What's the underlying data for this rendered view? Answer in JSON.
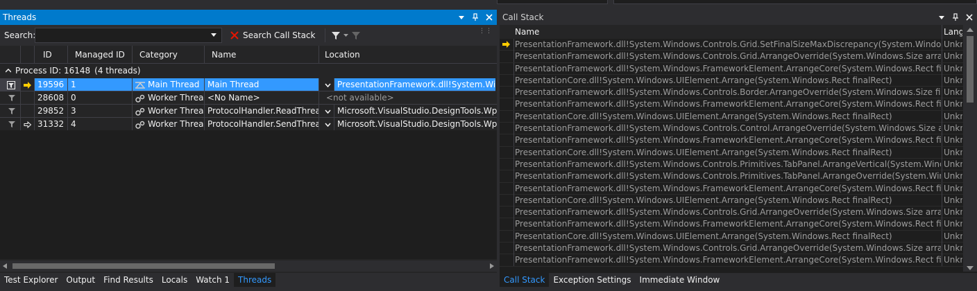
{
  "threads_panel": {
    "title": "Threads",
    "search_label": "Search:",
    "search_value": "",
    "search_call_stack_label": "Search Call Stack",
    "columns": [
      "ID",
      "Managed ID",
      "Category",
      "Name",
      "Location"
    ],
    "group_label": "Process ID: 16148",
    "group_count": "(4 threads)",
    "rows": [
      {
        "id": "19596",
        "managed_id": "1",
        "category": "Main Thread",
        "name": "Main Thread",
        "location": "PresentationFramework.dll!System.Windows.Controls.Grid.SetFinalSizeMaxDiscrepancy"
      },
      {
        "id": "28608",
        "managed_id": "0",
        "category": "Worker Thread",
        "name": "<No Name>",
        "location": "<not available>"
      },
      {
        "id": "29852",
        "managed_id": "3",
        "category": "Worker Thread",
        "name": "ProtocolHandler.ReadThread",
        "location": "Microsoft.VisualStudio.DesignTools.WpfTap.dll"
      },
      {
        "id": "31332",
        "managed_id": "4",
        "category": "Worker Thread",
        "name": "ProtocolHandler.SendThread",
        "location": "Microsoft.VisualStudio.DesignTools.WpfTap.dll"
      }
    ]
  },
  "bottom_tabs_left": [
    "Test Explorer",
    "Output",
    "Find Results",
    "Locals",
    "Watch 1",
    "Threads"
  ],
  "bottom_tabs_right": [
    "Call Stack",
    "Exception Settings",
    "Immediate Window"
  ],
  "callstack_panel": {
    "title": "Call Stack",
    "columns": [
      "Name",
      "Lang"
    ],
    "rows": [
      {
        "name": "PresentationFramework.dll!System.Windows.Controls.Grid.SetFinalSizeMaxDiscrepancy(System.Windows.Controls.Def",
        "lang": "Unkn"
      },
      {
        "name": "PresentationFramework.dll!System.Windows.Controls.Grid.ArrangeOverride(System.Windows.Size arrangeSize)",
        "lang": "Unkn"
      },
      {
        "name": "PresentationFramework.dll!System.Windows.FrameworkElement.ArrangeCore(System.Windows.Rect finalRect)",
        "lang": "Unkn"
      },
      {
        "name": "PresentationCore.dll!System.Windows.UIElement.Arrange(System.Windows.Rect finalRect)",
        "lang": "Unkn"
      },
      {
        "name": "PresentationFramework.dll!System.Windows.Controls.Border.ArrangeOverride(System.Windows.Size finalSize)",
        "lang": "Unkn"
      },
      {
        "name": "PresentationFramework.dll!System.Windows.FrameworkElement.ArrangeCore(System.Windows.Rect finalRect)",
        "lang": "Unkn"
      },
      {
        "name": "PresentationCore.dll!System.Windows.UIElement.Arrange(System.Windows.Rect finalRect)",
        "lang": "Unkn"
      },
      {
        "name": "PresentationFramework.dll!System.Windows.Controls.Control.ArrangeOverride(System.Windows.Size arrangeBounds)",
        "lang": "Unkn"
      },
      {
        "name": "PresentationFramework.dll!System.Windows.FrameworkElement.ArrangeCore(System.Windows.Rect finalRect)",
        "lang": "Unkn"
      },
      {
        "name": "PresentationCore.dll!System.Windows.UIElement.Arrange(System.Windows.Rect finalRect)",
        "lang": "Unkn"
      },
      {
        "name": "PresentationFramework.dll!System.Windows.Controls.Primitives.TabPanel.ArrangeVertical(System.Windows.Size arrang",
        "lang": "Unkn"
      },
      {
        "name": "PresentationFramework.dll!System.Windows.Controls.Primitives.TabPanel.ArrangeOverride(System.Windows.Size arra",
        "lang": "Unkn"
      },
      {
        "name": "PresentationFramework.dll!System.Windows.FrameworkElement.ArrangeCore(System.Windows.Rect finalRect)",
        "lang": "Unkn"
      },
      {
        "name": "PresentationCore.dll!System.Windows.UIElement.Arrange(System.Windows.Rect finalRect)",
        "lang": "Unkn"
      },
      {
        "name": "PresentationFramework.dll!System.Windows.Controls.Grid.ArrangeOverride(System.Windows.Size arrangeSize)",
        "lang": "Unkn"
      },
      {
        "name": "PresentationFramework.dll!System.Windows.FrameworkElement.ArrangeCore(System.Windows.Rect finalRect)",
        "lang": "Unkn"
      },
      {
        "name": "PresentationCore.dll!System.Windows.UIElement.Arrange(System.Windows.Rect finalRect)",
        "lang": "Unkn"
      },
      {
        "name": "PresentationFramework.dll!System.Windows.Controls.Grid.ArrangeOverride(System.Windows.Size arrangeSize)",
        "lang": "Unkn"
      },
      {
        "name": "PresentationFramework.dll!System.Windows.FrameworkElement.ArrangeCore(System.Windows.Rect finalRect)",
        "lang": "Unkn"
      }
    ]
  },
  "colors": {
    "accent": "#007acc",
    "selection": "#3399ff",
    "panel_bg": "#252526",
    "editor_bg": "#1e1e1e",
    "arrow_yellow": "#ffcc00"
  },
  "icons": {
    "current_thread": "yellow-arrow-icon",
    "flag": "flag-icon",
    "main_thread": "main-thread-icon",
    "worker_thread": "worker-thread-gears-icon",
    "search_clear": "red-x-icon",
    "filter": "filter-funnel-icon"
  }
}
